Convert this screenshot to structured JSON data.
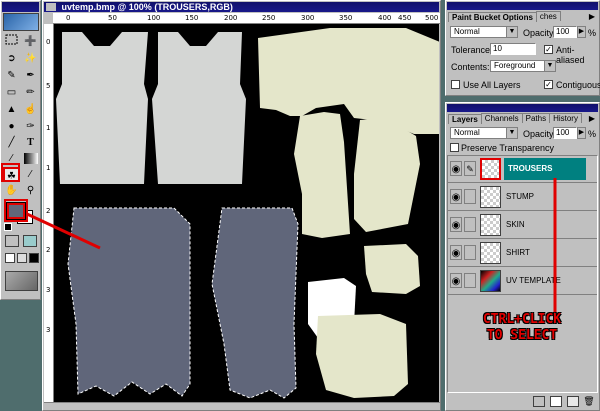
{
  "document": {
    "title": "uvtemp.bmp @ 100% (TROUSERS,RGB)",
    "ruler_h": [
      "0",
      "50",
      "100",
      "150",
      "200",
      "250",
      "300",
      "350",
      "400",
      "450",
      "500"
    ],
    "ruler_v": [
      "0",
      "5",
      "1",
      "1",
      "2",
      "2",
      "3",
      "3"
    ]
  },
  "toolbox": {
    "tools": [
      "marquee-icon",
      "move-icon",
      "lasso-icon",
      "magic-wand-icon",
      "airbrush-icon",
      "paintbrush-icon",
      "eraser-icon",
      "pencil-icon",
      "rubber-stamp-icon",
      "smudge-icon",
      "dodge-icon",
      "pen-icon",
      "text-icon",
      "line-icon",
      "gradient-icon",
      "paint-bucket-icon",
      "eyedropper-icon",
      "hand-icon",
      "zoom-icon"
    ],
    "selected_tool": "paint-bucket-icon",
    "foreground_color": "#60667a",
    "background_color": "#ffffff"
  },
  "paint_bucket_options": {
    "title": "Paint Bucket Options",
    "second_tab": "ches",
    "mode": "Normal",
    "opacity_label": "Opacity:",
    "opacity_value": "100",
    "percent": "%",
    "tolerance_label": "Tolerance:",
    "tolerance_value": "10",
    "anti_aliased_label": "Anti-aliased",
    "anti_aliased": true,
    "contents_label": "Contents:",
    "contents_value": "Foreground",
    "use_all_layers_label": "Use All Layers",
    "use_all_layers": false,
    "contiguous_label": "Contiguous",
    "contiguous": true
  },
  "layers_panel": {
    "tabs": [
      "Layers",
      "Channels",
      "Paths",
      "History"
    ],
    "mode": "Normal",
    "opacity_label": "Opacity:",
    "opacity_value": "100",
    "percent": "%",
    "preserve_transparency_label": "Preserve Transparency",
    "preserve_transparency": false,
    "layers": [
      {
        "name": "TROUSERS",
        "active": true,
        "visible": true
      },
      {
        "name": "STUMP",
        "active": false,
        "visible": true
      },
      {
        "name": "SKIN",
        "active": false,
        "visible": true
      },
      {
        "name": "SHIRT",
        "active": false,
        "visible": true
      },
      {
        "name": "UV TEMPLATE",
        "active": false,
        "visible": true
      }
    ]
  },
  "annotation": {
    "line1": "CTRL+CLICK",
    "line2": "TO SELECT",
    "color": "#e00000"
  },
  "colors": {
    "shirt_gray": "#d4d6d4",
    "skin_cream": "#e4e6ca",
    "trousers_blue": "#60667a",
    "stump_white": "#ffffff",
    "layer_highlight": "#008080"
  }
}
